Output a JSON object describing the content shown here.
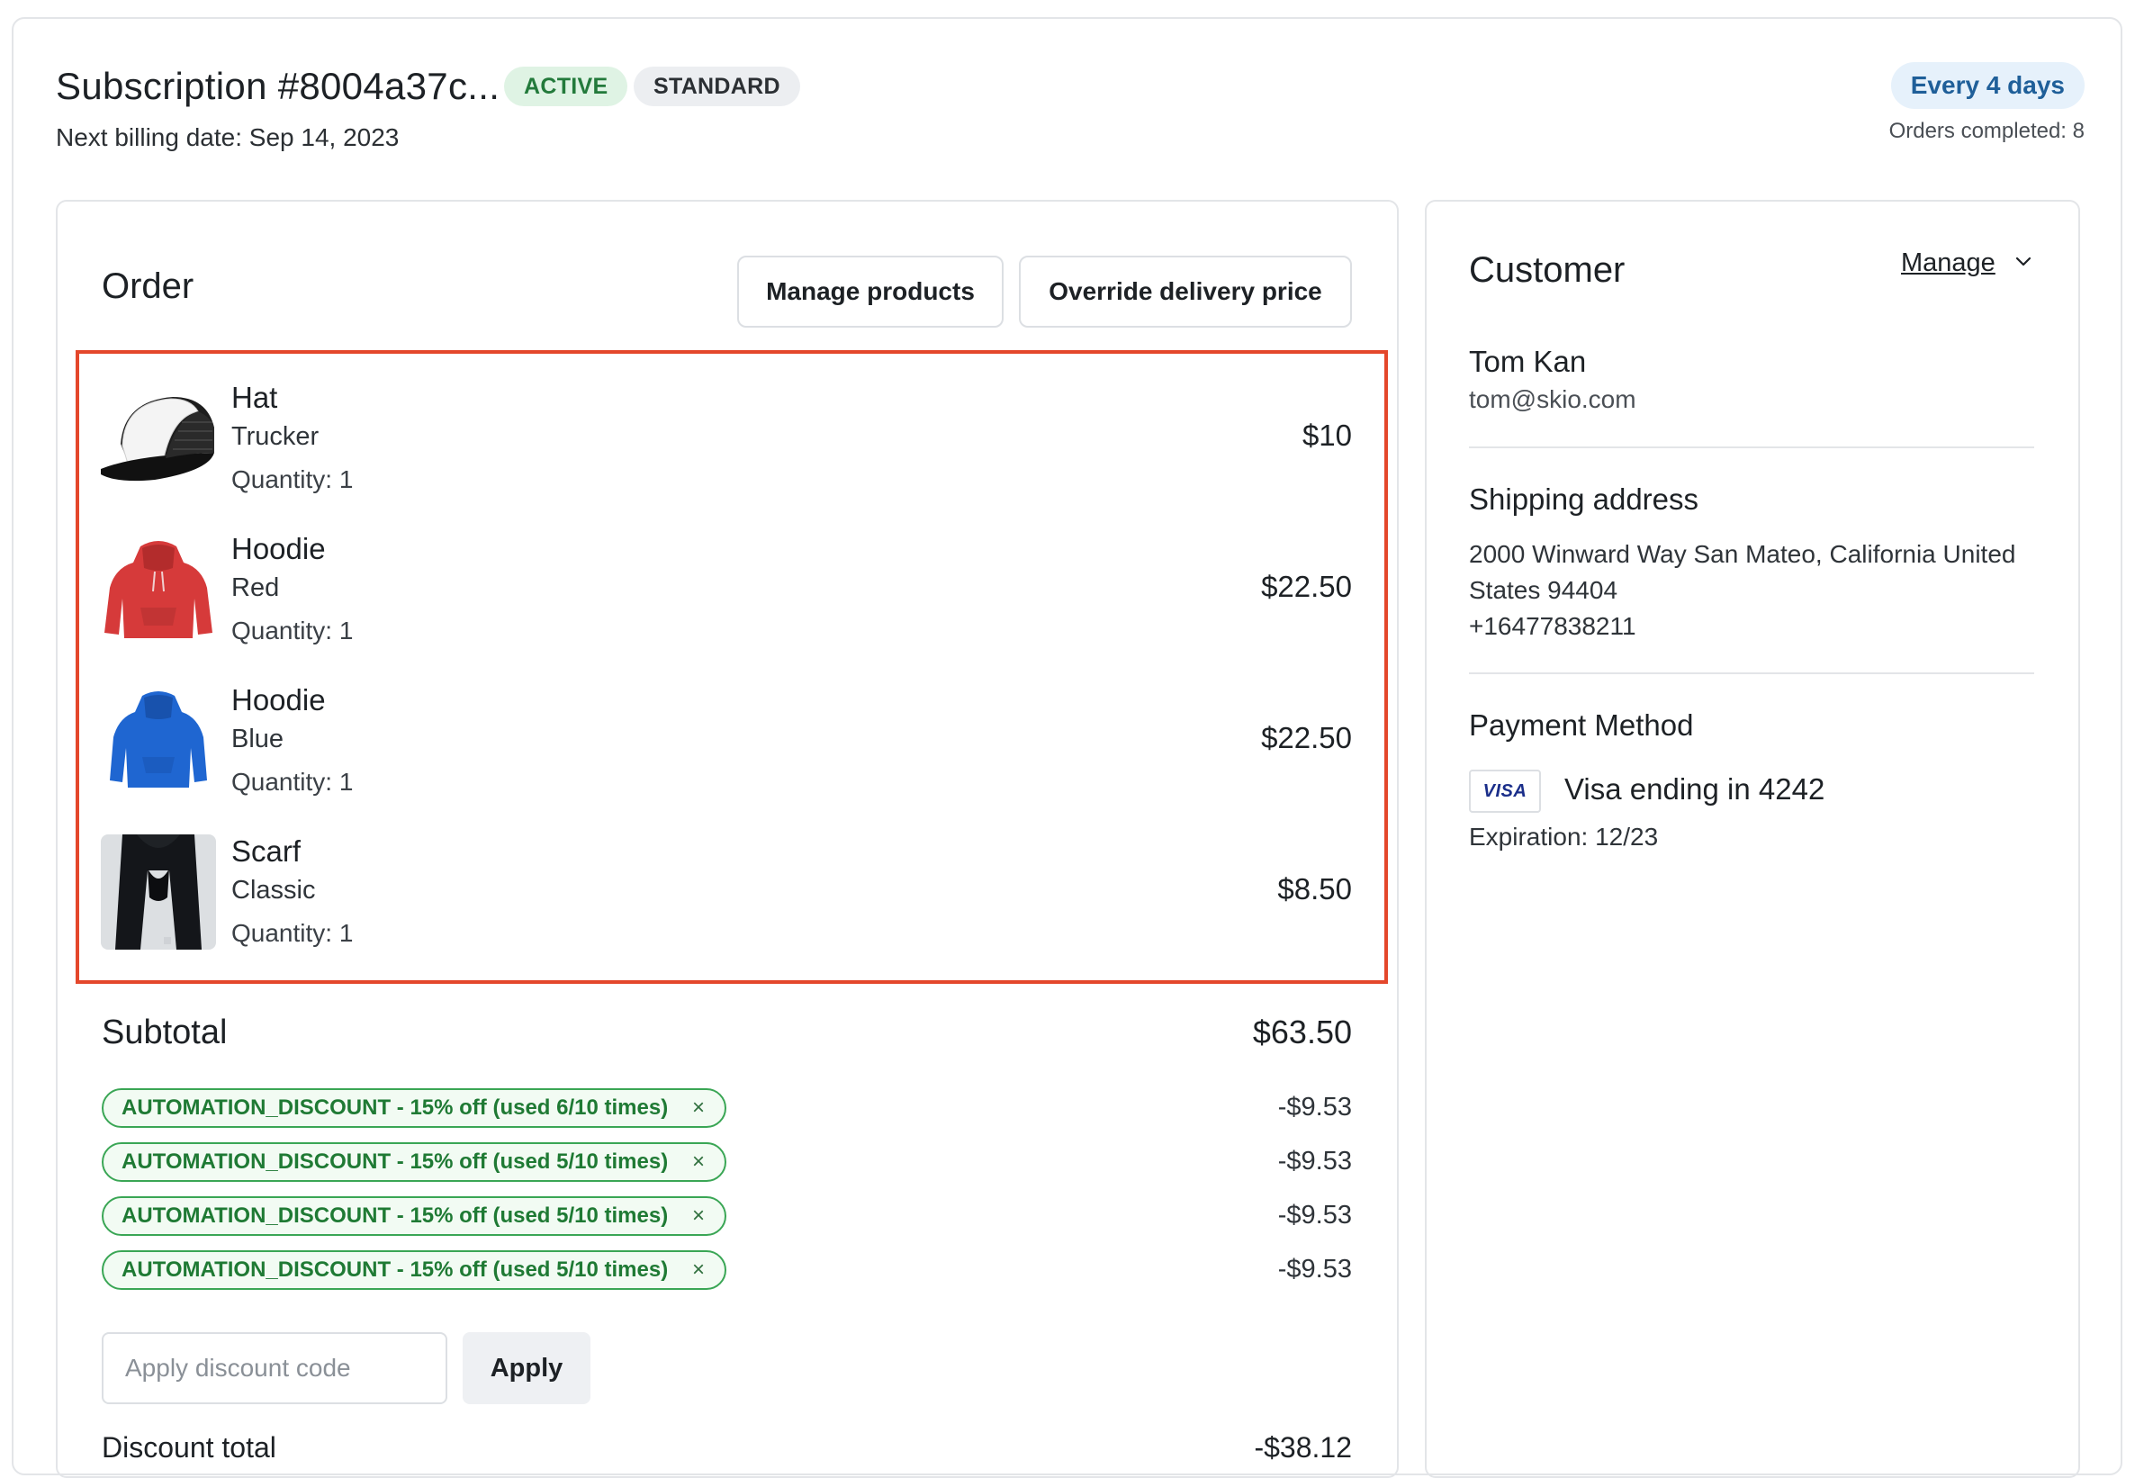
{
  "subscription": {
    "title": "Subscription #8004a37c...",
    "status_badge": "ACTIVE",
    "plan_badge": "STANDARD",
    "next_billing": "Next billing date: Sep 14, 2023",
    "frequency": "Every 4 days",
    "orders_completed": "Orders completed: 8"
  },
  "order": {
    "title": "Order",
    "manage_products_label": "Manage products",
    "override_delivery_label": "Override delivery price",
    "items": [
      {
        "name": "Hat",
        "variant": "Trucker",
        "quantity": "Quantity: 1",
        "price": "$10",
        "image": "trucker-hat"
      },
      {
        "name": "Hoodie",
        "variant": "Red",
        "quantity": "Quantity: 1",
        "price": "$22.50",
        "image": "red-hoodie"
      },
      {
        "name": "Hoodie",
        "variant": "Blue",
        "quantity": "Quantity: 1",
        "price": "$22.50",
        "image": "blue-hoodie"
      },
      {
        "name": "Scarf",
        "variant": "Classic",
        "quantity": "Quantity: 1",
        "price": "$8.50",
        "image": "black-scarf"
      }
    ],
    "subtotal_label": "Subtotal",
    "subtotal_value": "$63.50",
    "discounts": [
      {
        "label": "AUTOMATION_DISCOUNT - 15% off (used 6/10 times)",
        "amount": "-$9.53"
      },
      {
        "label": "AUTOMATION_DISCOUNT - 15% off (used 5/10 times)",
        "amount": "-$9.53"
      },
      {
        "label": "AUTOMATION_DISCOUNT - 15% off (used 5/10 times)",
        "amount": "-$9.53"
      },
      {
        "label": "AUTOMATION_DISCOUNT - 15% off (used 5/10 times)",
        "amount": "-$9.53"
      }
    ],
    "remove_glyph": "×",
    "discount_placeholder": "Apply discount code",
    "apply_label": "Apply",
    "discount_total_label": "Discount total",
    "discount_total_value": "-$38.12"
  },
  "customer": {
    "title": "Customer",
    "manage_label": "Manage",
    "name": "Tom Kan",
    "email": "tom@skio.com",
    "shipping_title": "Shipping address",
    "shipping_address": "2000 Winward Way San Mateo, California United States 94404",
    "phone": "+16477838211",
    "payment_title": "Payment Method",
    "card_brand": "VISA",
    "card_text": "Visa ending in 4242",
    "expiration": "Expiration: 12/23"
  },
  "colors": {
    "highlight": "#e4472b",
    "active_badge_bg": "#dff3e4",
    "discount_green": "#1f7a34",
    "frequency_blue": "#1f5f99"
  }
}
